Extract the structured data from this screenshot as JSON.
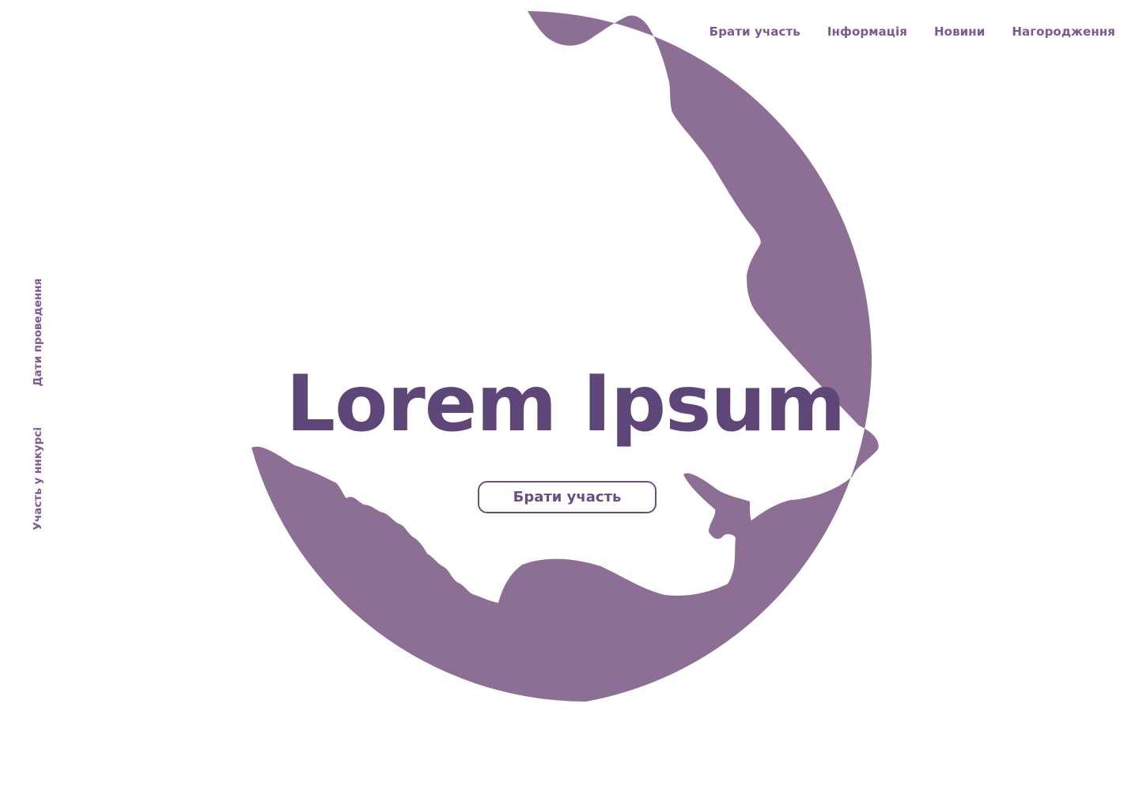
{
  "brand": {
    "accent": "#8d6e95",
    "heading_color": "#5f4679",
    "link_color": "#7a5a91"
  },
  "header": {
    "nav": [
      {
        "label": "Брати участь"
      },
      {
        "label": "Інформація"
      },
      {
        "label": "Новини"
      },
      {
        "label": "Нагородження"
      }
    ]
  },
  "sidebar": {
    "items": [
      {
        "label": "Дати проведення"
      },
      {
        "label": "Участь у ннкурсі"
      }
    ]
  },
  "hero": {
    "title": "Lorem Ipsum",
    "cta_label": "Брати участь",
    "image_icon": "wolf-head-moon-icon"
  }
}
